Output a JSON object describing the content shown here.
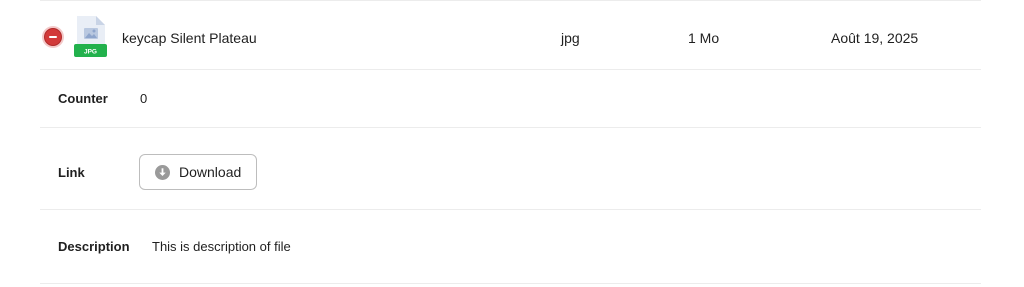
{
  "file": {
    "name": "keycap Silent Plateau",
    "type": "jpg",
    "size": "1 Mo",
    "date": "Août 19, 2025",
    "icon": "jpg-file-icon",
    "badge": "JPG",
    "badge_color": "#22b14c"
  },
  "details": {
    "counter_label": "Counter",
    "counter_value": "0",
    "link_label": "Link",
    "download_label": "Download",
    "description_label": "Description",
    "description_value": "This is description of file"
  },
  "colors": {
    "remove": "#d23a3a",
    "divider": "#ececec"
  }
}
